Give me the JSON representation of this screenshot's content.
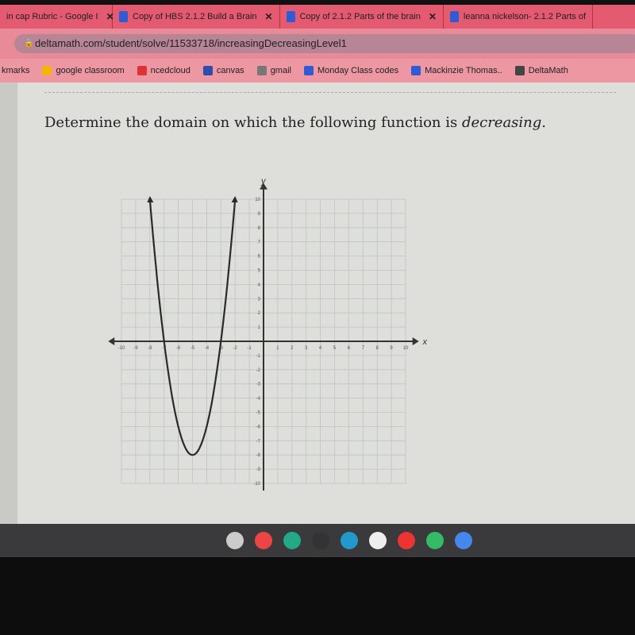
{
  "tabs": [
    {
      "title": "in cap Rubric - Google I",
      "icon": "docs-icon"
    },
    {
      "title": "Copy of HBS 2.1.2 Build a Brain",
      "icon": "docs-icon"
    },
    {
      "title": "Copy of 2.1.2 Parts of the brain",
      "icon": "docs-icon"
    },
    {
      "title": "leanna nickelson- 2.1.2 Parts of",
      "icon": "docs-icon"
    }
  ],
  "address": {
    "url": "deltamath.com/student/solve/11533718/increasingDecreasingLevel1"
  },
  "bookmarks": [
    {
      "label": "kmarks"
    },
    {
      "label": "google classroom",
      "color": "#f4b400"
    },
    {
      "label": "ncedcloud",
      "color": "#d33"
    },
    {
      "label": "canvas",
      "color": "#2a4fb0"
    },
    {
      "label": "gmail",
      "color": "#777"
    },
    {
      "label": "Monday Class codes",
      "color": "#2f5bd6"
    },
    {
      "label": "Mackinzie Thomas..",
      "color": "#2f5bd6"
    },
    {
      "label": "DeltaMath",
      "color": "#444"
    }
  ],
  "question": {
    "prefix": "Determine the domain on which the following function is ",
    "emphasis": "decreasing",
    "suffix": "."
  },
  "chart_data": {
    "type": "line",
    "xlabel": "x",
    "ylabel": "y",
    "xlim": [
      -10,
      10
    ],
    "ylim": [
      -10,
      10
    ],
    "xticks": [
      -10,
      -9,
      -8,
      -7,
      -6,
      -5,
      -4,
      -3,
      -2,
      -1,
      1,
      2,
      3,
      4,
      5,
      6,
      7,
      8,
      9,
      10
    ],
    "yticks": [
      -10,
      -9,
      -8,
      -7,
      -6,
      -5,
      -4,
      -3,
      -2,
      -1,
      1,
      2,
      3,
      4,
      5,
      6,
      7,
      8,
      9,
      10
    ],
    "grid": true,
    "curve": {
      "kind": "parabola",
      "vertex": [
        -5,
        -8
      ],
      "roots": [
        -7,
        -3
      ],
      "endpoints": [
        [
          -8,
          10
        ],
        [
          -2,
          10
        ]
      ],
      "arrows": true
    }
  },
  "taskbar": {
    "apps": [
      "files-icon",
      "meet-icon",
      "drive-icon",
      "app-icon",
      "dots-app-icon",
      "camera-icon",
      "chrome-icon",
      "play-store-icon",
      "files-folder-icon"
    ]
  }
}
